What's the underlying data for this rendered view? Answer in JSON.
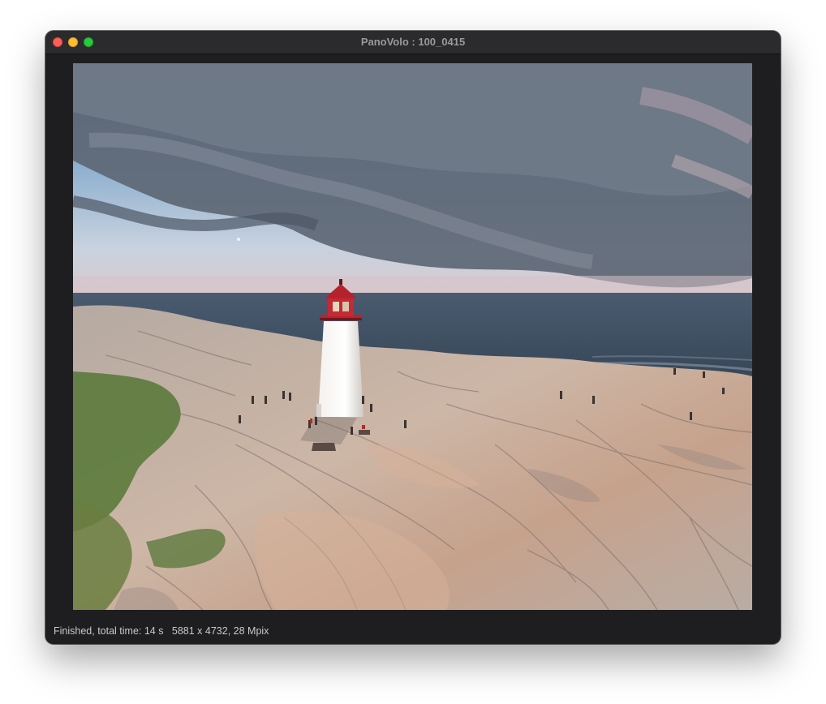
{
  "window": {
    "title": "PanoVolo : 100_0415"
  },
  "status": {
    "text": "Finished, total time: 14 s   5881 x 4732, 28 Mpix"
  }
}
